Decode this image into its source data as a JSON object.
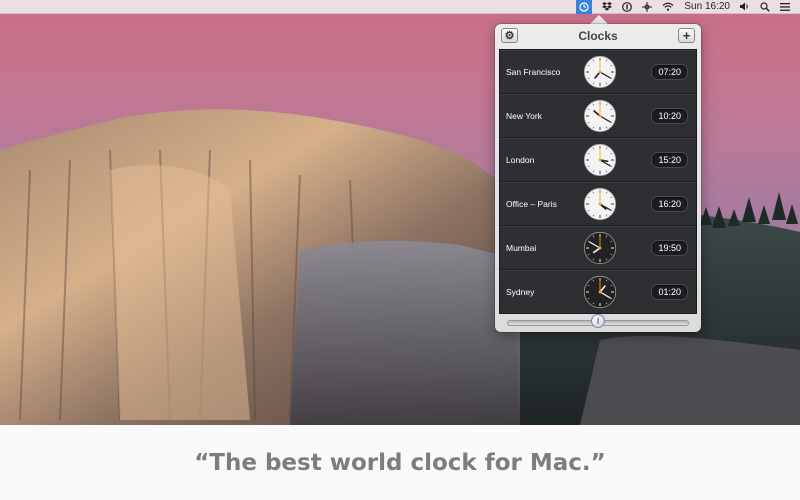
{
  "menubar": {
    "app_icon": "clock-icon",
    "icons": [
      "dropbox-icon",
      "onepassword-icon",
      "network-icon",
      "wifi-icon",
      "volume-icon",
      "search-icon",
      "list-icon"
    ],
    "time": "Sun 16:20"
  },
  "popover": {
    "title": "Clocks",
    "settings_icon": "gear-icon",
    "add_icon": "plus-icon",
    "clocks": [
      {
        "city": "San Francisco",
        "time": "07:20",
        "face": "light",
        "hour": 7,
        "minute": 20
      },
      {
        "city": "New York",
        "time": "10:20",
        "face": "light",
        "hour": 10,
        "minute": 20
      },
      {
        "city": "London",
        "time": "15:20",
        "face": "light",
        "hour": 15,
        "minute": 20
      },
      {
        "city": "Office – Paris",
        "time": "16:20",
        "face": "light",
        "hour": 16,
        "minute": 20
      },
      {
        "city": "Mumbai",
        "time": "19:50",
        "face": "dark",
        "hour": 19,
        "minute": 50
      },
      {
        "city": "Sydney",
        "time": "01:20",
        "face": "dark",
        "hour": 1,
        "minute": 20
      }
    ],
    "time_slider": {
      "value": 0.5
    }
  },
  "tagline": "“The best world clock for Mac.”",
  "colors": {
    "accent": "#3b82e0",
    "hand_accent": "#f5a623"
  }
}
